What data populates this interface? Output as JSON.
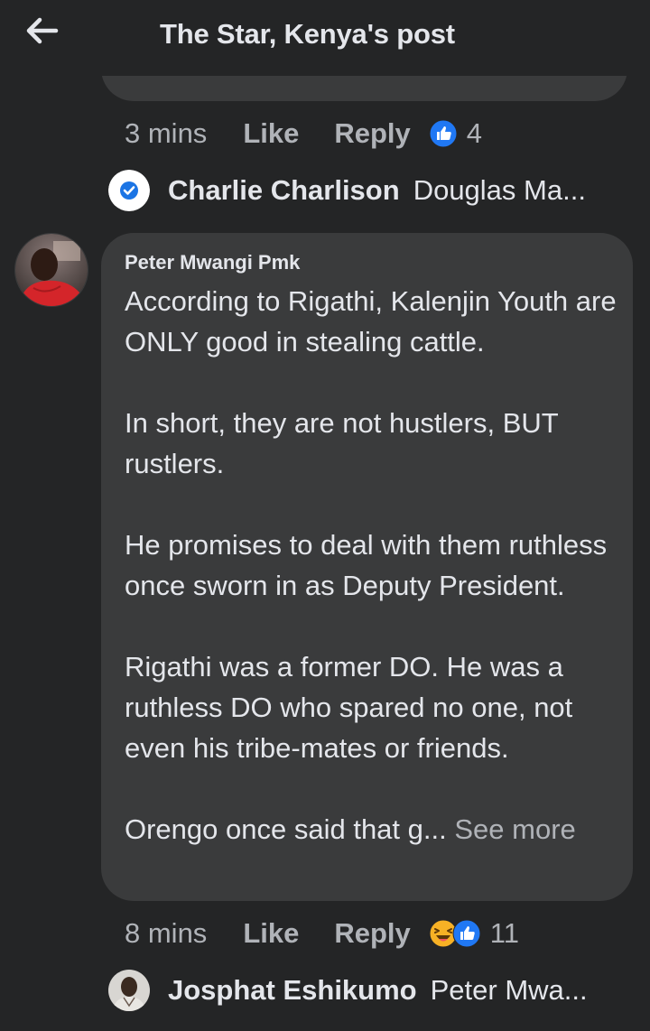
{
  "header": {
    "title": "The Star, Kenya's post"
  },
  "previous_comment": {
    "time": "3 mins",
    "like_label": "Like",
    "reply_label": "Reply",
    "reaction_count": "4",
    "reactions": [
      "like-icon"
    ],
    "reply_preview": {
      "name": "Charlie Charlison",
      "snippet": "Douglas Ma..."
    }
  },
  "comment": {
    "author": "Peter Mwangi Pmk",
    "paragraphs": [
      "According to Rigathi, Kalenjin Youth are ONLY good in stealing cattle.",
      "In short, they are not hustlers, BUT rustlers.",
      "He promises to deal with them ruthless once sworn in as Deputy President.",
      "Rigathi was a former DO. He was a ruthless DO who spared no one, not even his tribe-mates or friends.",
      "Orengo once said that g..."
    ],
    "see_more": "See more",
    "time": "8 mins",
    "like_label": "Like",
    "reply_label": "Reply",
    "reaction_count": "11",
    "reactions": [
      "haha-icon",
      "like-icon"
    ],
    "reply_preview": {
      "name": "Josphat Eshikumo",
      "snippet": "Peter Mwa..."
    }
  },
  "colors": {
    "background": "#242526",
    "bubble": "#3a3b3c",
    "primary_text": "#e4e6eb",
    "secondary_text": "#b0b3b8",
    "like_blue": "#2078f4",
    "haha_yellow": "#f7b125"
  }
}
